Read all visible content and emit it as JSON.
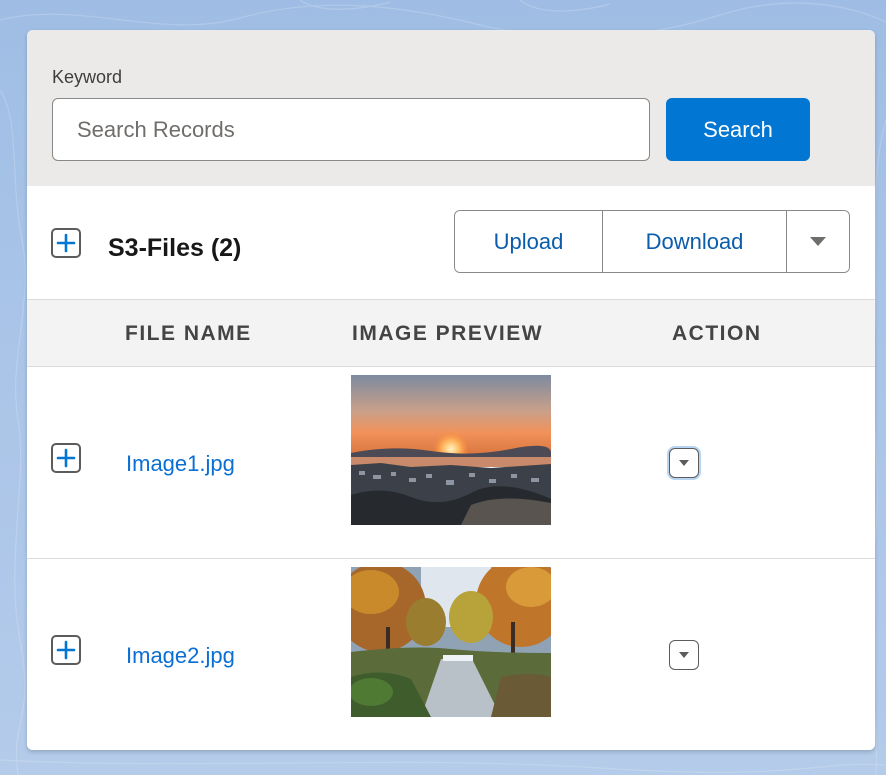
{
  "search": {
    "label": "Keyword",
    "placeholder": "Search Records",
    "value": "",
    "button_label": "Search"
  },
  "files": {
    "title": "S3-Files (2)",
    "actions": {
      "upload_label": "Upload",
      "download_label": "Download",
      "more_icon": "caret-down-icon"
    }
  },
  "table": {
    "columns": [
      "FILE NAME",
      "IMAGE PREVIEW",
      "ACTION"
    ],
    "rows": [
      {
        "file_name": "Image1.jpg",
        "preview": "sunset over bay town"
      },
      {
        "file_name": "Image2.jpg",
        "preview": "autumn park river"
      }
    ]
  },
  "colors": {
    "accent": "#0176d3",
    "link": "#0b6fd3",
    "panel_bg": "#eceae8",
    "table_head_bg": "#f3f3f3"
  },
  "icons": {
    "expand": "plus-icon",
    "row_action": "chevron-down-icon"
  }
}
